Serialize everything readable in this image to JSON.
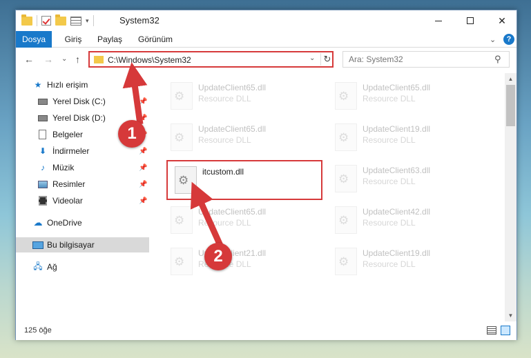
{
  "window": {
    "title": "System32"
  },
  "ribbon": {
    "tabs": [
      "Dosya",
      "Giriş",
      "Paylaş",
      "Görünüm"
    ]
  },
  "address": {
    "path": "C:\\Windows\\System32"
  },
  "search": {
    "placeholder": "Ara: System32"
  },
  "sidebar": {
    "items": [
      {
        "label": "Hızlı erişim",
        "icon": "star-icon"
      },
      {
        "label": "Yerel Disk (C:)",
        "icon": "drive-icon",
        "pinned": true
      },
      {
        "label": "Yerel Disk (D:)",
        "icon": "drive-icon",
        "pinned": true
      },
      {
        "label": "Belgeler",
        "icon": "document-icon",
        "pinned": true
      },
      {
        "label": "İndirmeler",
        "icon": "download-icon",
        "pinned": true
      },
      {
        "label": "Müzik",
        "icon": "music-icon",
        "pinned": true
      },
      {
        "label": "Resimler",
        "icon": "pictures-icon",
        "pinned": true
      },
      {
        "label": "Videolar",
        "icon": "videos-icon",
        "pinned": true
      },
      {
        "label": "OneDrive",
        "icon": "cloud-icon"
      },
      {
        "label": "Bu bilgisayar",
        "icon": "computer-icon",
        "selected": true
      },
      {
        "label": "Ağ",
        "icon": "network-icon"
      }
    ]
  },
  "files": [
    {
      "name": "UpdateClient65.dll",
      "type": "Resource DLL",
      "faded": true
    },
    {
      "name": "UpdateClient65.dll",
      "type": "Resource DLL",
      "faded": true
    },
    {
      "name": "UpdateClient65.dll",
      "type": "Resource DLL",
      "faded": true
    },
    {
      "name": "UpdateClient19.dll",
      "type": "Resource DLL",
      "faded": true
    },
    {
      "name": "itcustom.dll",
      "type": "",
      "faded": false,
      "highlighted": true
    },
    {
      "name": "UpdateClient63.dll",
      "type": "Resource DLL",
      "faded": true
    },
    {
      "name": "UpdateClient65.dll",
      "type": "Resource DLL",
      "faded": true
    },
    {
      "name": "UpdateClient42.dll",
      "type": "Resource DLL",
      "faded": true
    },
    {
      "name": "UpdateClient21.dll",
      "type": "Resource DLL",
      "faded": true
    },
    {
      "name": "UpdateClient19.dll",
      "type": "Resource DLL",
      "faded": true
    }
  ],
  "status": {
    "count": "125 öğe"
  },
  "callouts": [
    "1",
    "2"
  ],
  "colors": {
    "accent": "#1979ca",
    "annotation": "#d6393a",
    "selected_nav": "#d9d9d9"
  }
}
